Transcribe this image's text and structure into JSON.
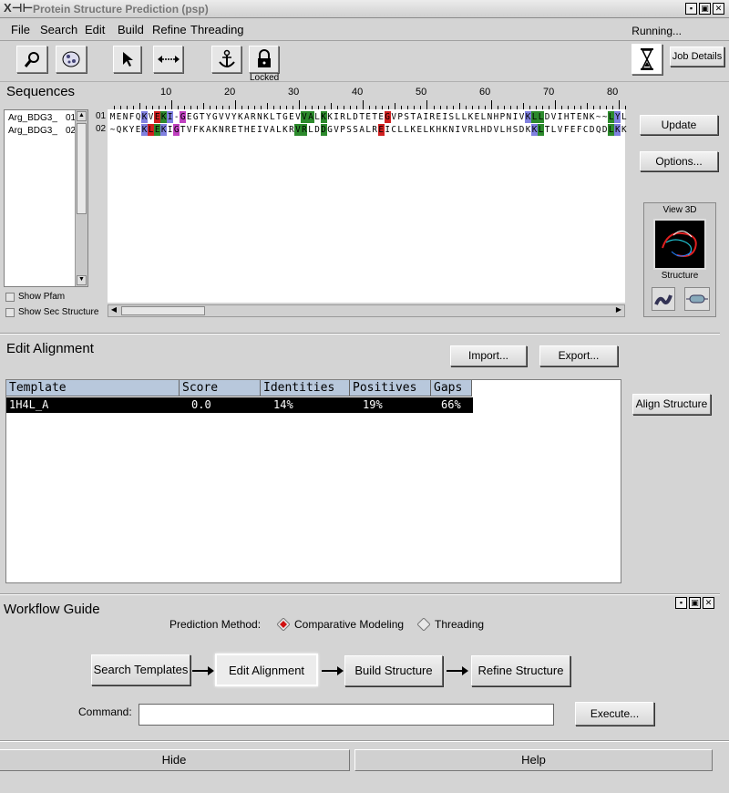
{
  "window": {
    "title": "Protein Structure Prediction (psp)",
    "logo": "X⊣⊢",
    "controls": [
      "▪",
      "▣",
      "✕"
    ]
  },
  "menu": {
    "items": [
      "File",
      "Search",
      "Edit",
      "Build",
      "Refine",
      "Threading"
    ],
    "status": "Running..."
  },
  "toolbar": {
    "locked_label": "Locked",
    "job_details_label": "Job Details"
  },
  "sequences": {
    "title": "Sequences",
    "list": [
      {
        "name": "Arg_BDG3_",
        "num": "01"
      },
      {
        "name": "Arg_BDG3_",
        "num": "02"
      }
    ],
    "show_pfam_label": "Show Pfam",
    "show_sec_label": "Show Sec Structure",
    "ruler_labels": [
      "10",
      "20",
      "30",
      "40",
      "50",
      "60",
      "70",
      "80"
    ],
    "row_numbers": [
      "01",
      "02"
    ],
    "seq1": "MENFQKVEKI-GEGTYGVVYKARNKLTGEVVALKKIRLDTETEGVPSTAIREISLLKELNHPNIVKLLDVIHTENK~~LYL",
    "seq2": "~QKYEKLEKIGTVFKAKNRETHEIVALKRVRLDDGVPSSALREICLLKELKHKNIVRLHDVLHSDKKLTLVFEFCDQDLKK",
    "update_label": "Update",
    "options_label": "Options...",
    "view3d_label": "View 3D",
    "structure_label": "Structure"
  },
  "edit_alignment": {
    "title": "Edit Alignment",
    "import_label": "Import...",
    "export_label": "Export...",
    "align_structure_label": "Align Structure",
    "columns": [
      "Template",
      "Score",
      "Identities",
      "Positives",
      "Gaps"
    ],
    "rows": [
      {
        "template": "1H4L_A",
        "score": "0.0",
        "identities": "14%",
        "positives": "19%",
        "gaps": "66%"
      }
    ]
  },
  "workflow": {
    "title": "Workflow Guide",
    "prediction_method_label": "Prediction Method:",
    "method_comparative": "Comparative Modeling",
    "method_threading": "Threading",
    "steps": [
      "Search Templates",
      "Edit Alignment",
      "Build Structure",
      "Refine Structure"
    ],
    "command_label": "Command:",
    "command_value": "",
    "execute_label": "Execute..."
  },
  "bottom": {
    "hide_label": "Hide",
    "help_label": "Help"
  },
  "colors": {
    "residue_blue": "#8080e0",
    "residue_red": "#d02020",
    "residue_green": "#2c8a2c",
    "residue_magenta": "#c040c0",
    "table_header": "#b8c8dc",
    "selected_row": "#000000"
  }
}
